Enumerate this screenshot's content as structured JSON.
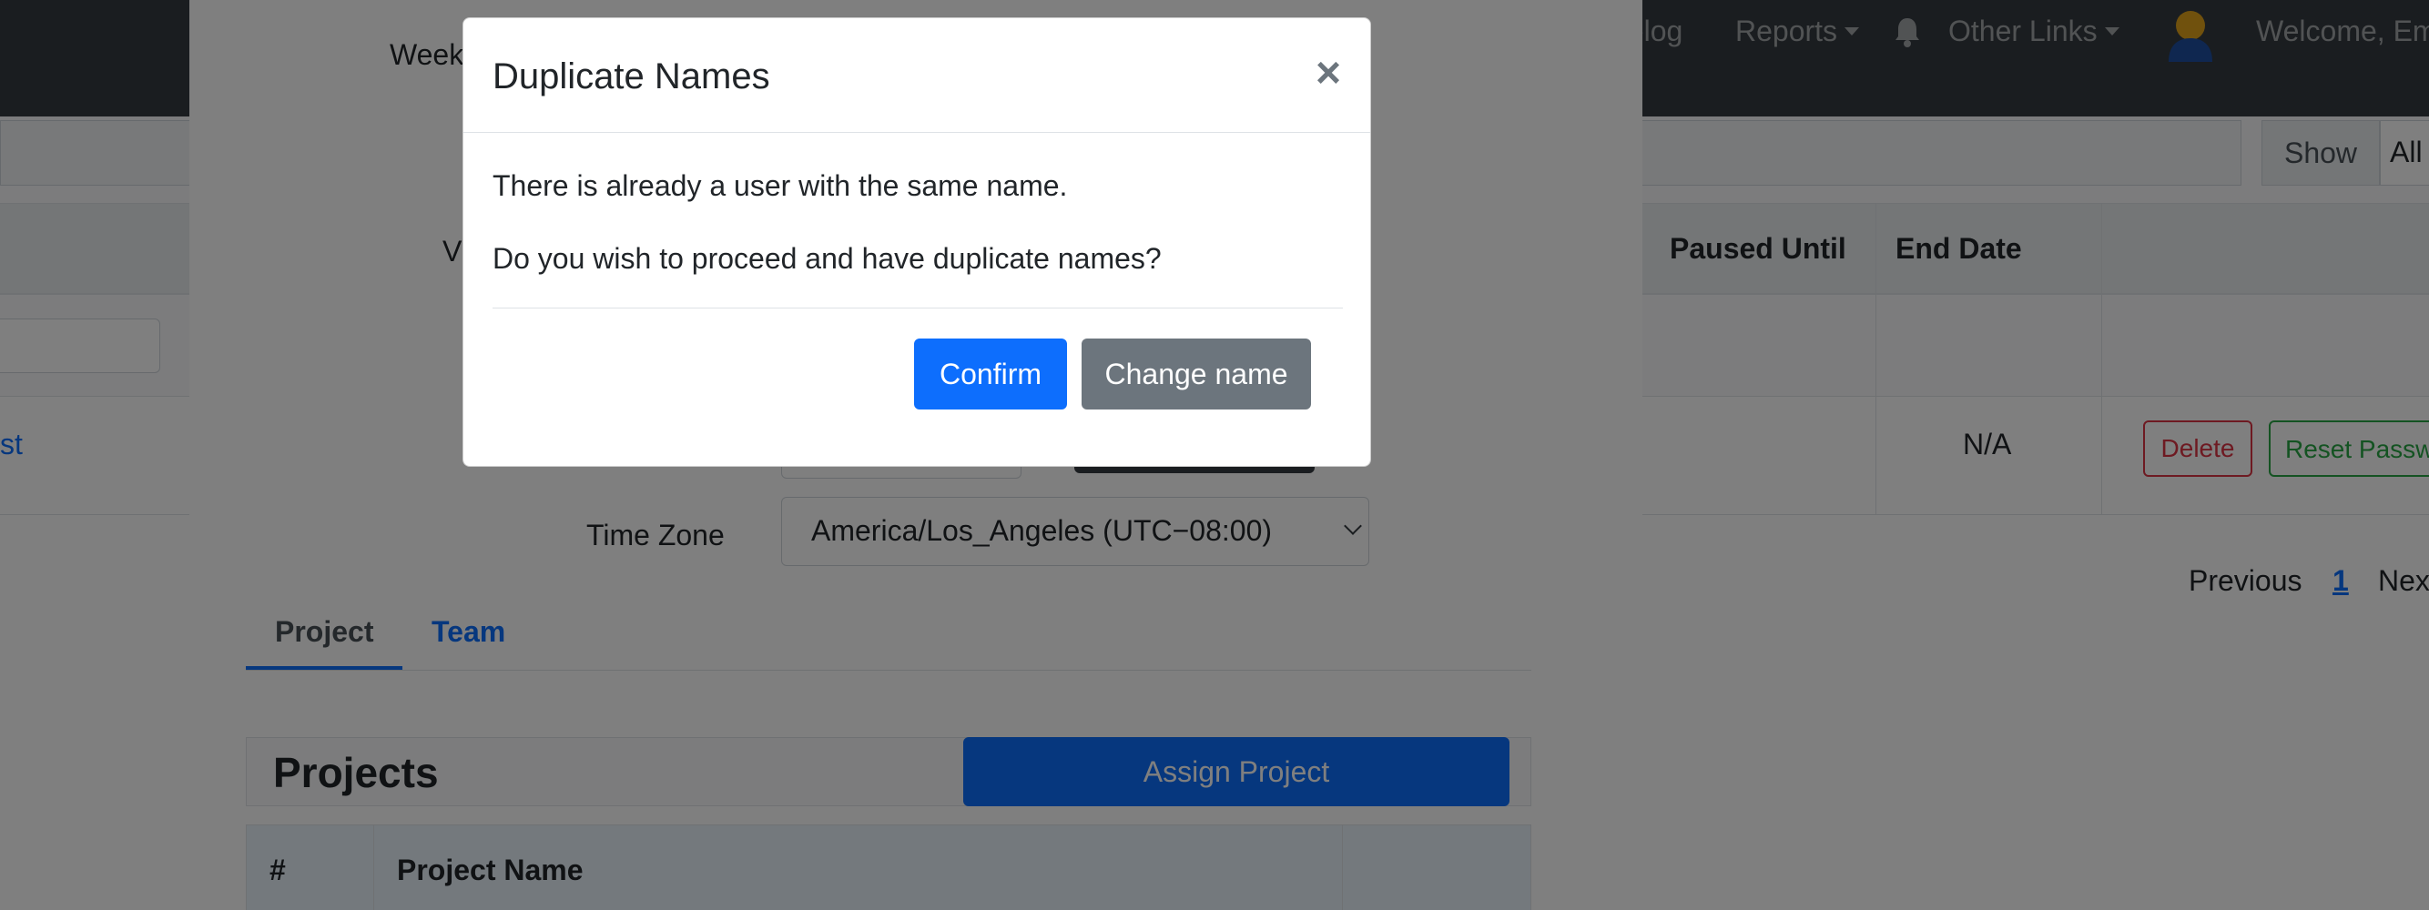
{
  "navbar": {
    "items": [
      {
        "label": "nelog"
      },
      {
        "label": "Reports"
      },
      {
        "label": "Other Links"
      }
    ],
    "welcome": "Welcome, Em"
  },
  "toolbar": {
    "show_label": "Show",
    "show_value": "All"
  },
  "table": {
    "headers": {
      "paused_until": "Paused Until",
      "end_date": "End Date"
    },
    "row": {
      "link_fragment": "st",
      "end_date": "N/A",
      "delete_label": "Delete",
      "reset_label": "Reset Passw"
    }
  },
  "pagination": {
    "previous": "Previous",
    "current": "1",
    "next": "Nex"
  },
  "user_form": {
    "week_label": "Week",
    "v_label": "V",
    "timezone_label": "Time Zone",
    "timezone_value": "America/Los_Angeles (UTC−08:00)",
    "tabs": [
      {
        "label": "Project",
        "active": true
      },
      {
        "label": "Team",
        "active": false
      }
    ],
    "projects_title": "Projects",
    "assign_button": "Assign Project",
    "project_table_headers": {
      "index": "#",
      "name": "Project Name"
    }
  },
  "dialog": {
    "title": "Duplicate Names",
    "close_symbol": "×",
    "message": "There is already a user with the same name.",
    "question": "Do you wish to proceed and have duplicate names?",
    "confirm_label": "Confirm",
    "change_label": "Change name"
  },
  "colors": {
    "primary": "#0d6efd",
    "secondary": "#6c757d",
    "navbar": "#343a40",
    "danger": "#dc3545",
    "success": "#28a745"
  }
}
